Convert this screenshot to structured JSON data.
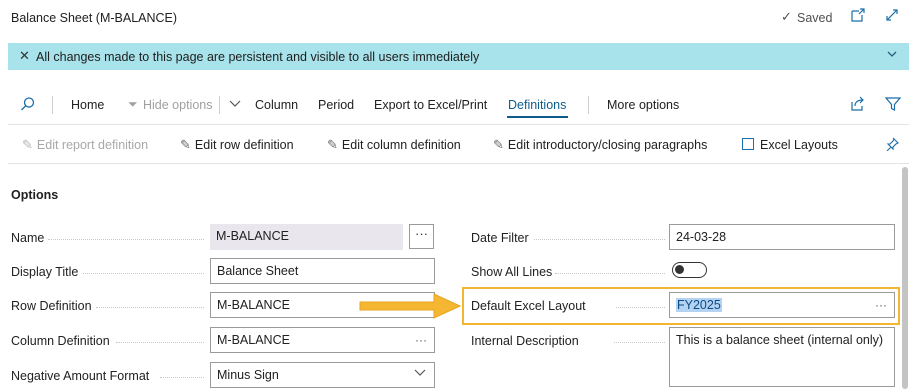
{
  "window": {
    "title": "Balance Sheet (M-BALANCE)",
    "status": "Saved",
    "icons": [
      "checkmark-icon",
      "open-new-window-icon",
      "expand-icon"
    ]
  },
  "banner": {
    "text": "All changes made to this page are persistent and visible to all users immediately"
  },
  "actions": {
    "home": "Home",
    "hide_options": "Hide options",
    "column": "Column",
    "period": "Period",
    "export": "Export to Excel/Print",
    "definitions": "Definitions",
    "more": "More options"
  },
  "subactions": {
    "edit_report": "Edit report definition",
    "edit_row": "Edit row definition",
    "edit_column": "Edit column definition",
    "edit_paragraphs": "Edit introductory/closing paragraphs",
    "excel_layouts": "Excel Layouts"
  },
  "options": {
    "heading": "Options",
    "name": {
      "label": "Name",
      "value": "M-BALANCE"
    },
    "display_title": {
      "label": "Display Title",
      "value": "Balance Sheet"
    },
    "row_definition": {
      "label": "Row Definition",
      "value": "M-BALANCE"
    },
    "column_definition": {
      "label": "Column Definition",
      "value": "M-BALANCE"
    },
    "negative_format": {
      "label": "Negative Amount Format",
      "value": "Minus Sign"
    },
    "date_filter": {
      "label": "Date Filter",
      "value": "24-03-28"
    },
    "show_all_lines": {
      "label": "Show All Lines",
      "value": "off"
    },
    "default_excel_layout": {
      "label": "Default Excel Layout",
      "value": "FY2025"
    },
    "internal_description": {
      "label": "Internal Description",
      "value": "This is a balance sheet (internal only)"
    }
  },
  "colors": {
    "banner_bg": "#a8e2ea",
    "accent": "#0e5c8c",
    "highlight": "#f2b632",
    "arrow": "#f5b731"
  }
}
